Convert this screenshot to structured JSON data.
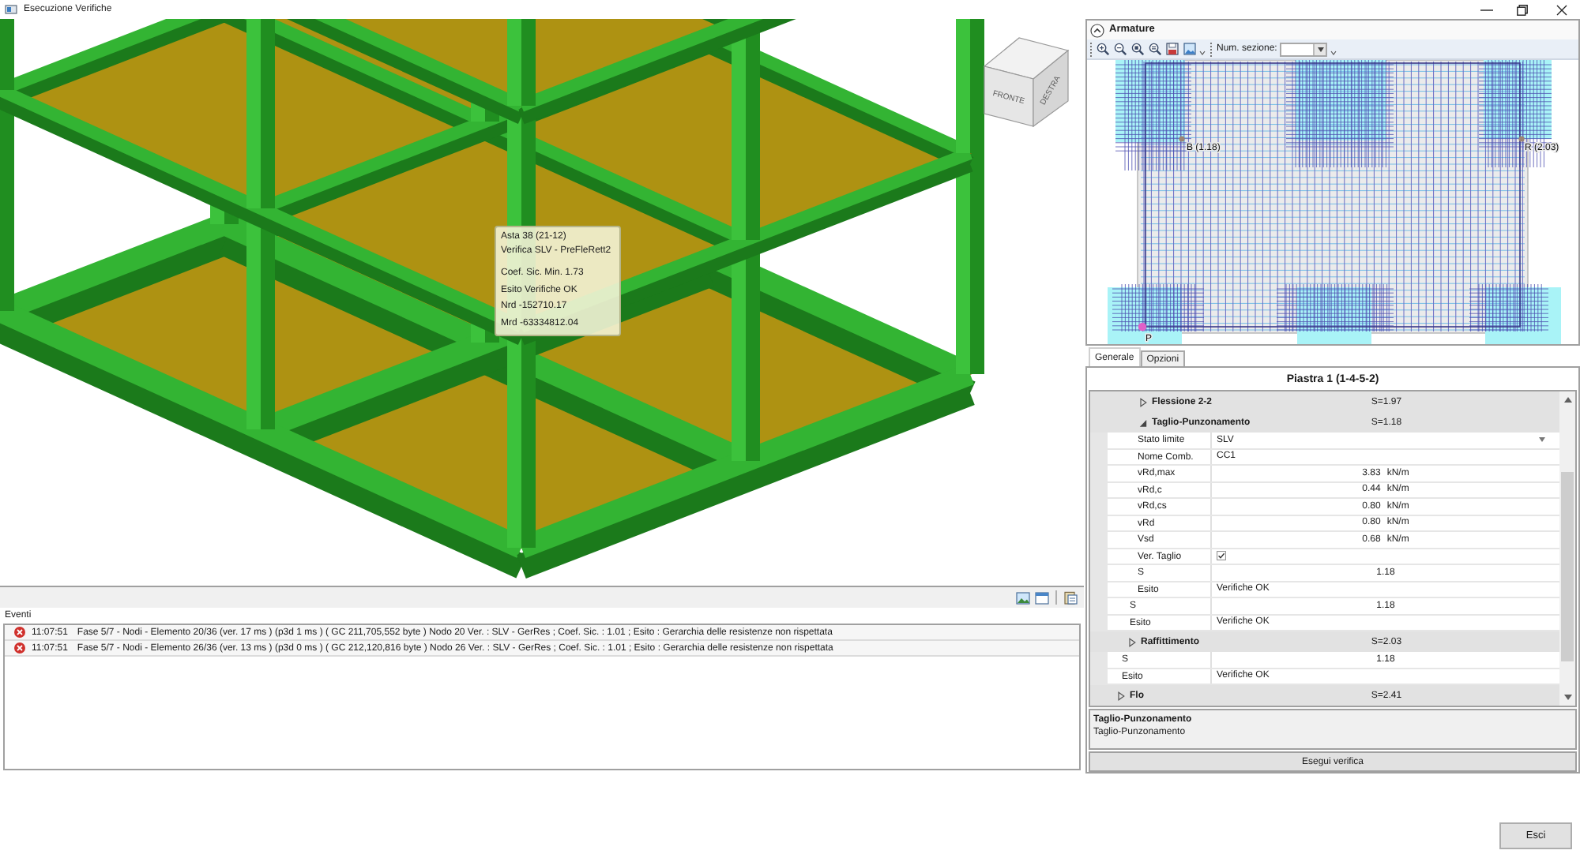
{
  "window": {
    "title": "Esecuzione Verifiche"
  },
  "viewport": {
    "tooltip": {
      "header": [
        "Asta 38 (21-12)",
        "Verifica SLV - PreFleRett2"
      ],
      "lines": [
        "Coef. Sic. Min. 1.73",
        "Esito Verifiche OK",
        "Nrd -152710.17",
        "Mrd -63334812.04"
      ]
    },
    "view_cube": {
      "front": "FRONTE",
      "right": "DESTRA"
    }
  },
  "events": {
    "label": "Eventi",
    "rows": [
      {
        "kind": "error",
        "time": "11:07:51",
        "message": "Fase 5/7 - Nodi - Elemento 20/36 (ver. 17 ms ) (p3d 1 ms ) ( GC 211,705,552 byte ) Nodo 20 Ver. : SLV - GerRes ; Coef. Sic. : 1.01 ; Esito : Gerarchia delle resistenze non rispettata"
      },
      {
        "kind": "error",
        "time": "11:07:51",
        "message": "Fase 5/7 - Nodi - Elemento 26/36 (ver. 13 ms ) (p3d 0 ms ) ( GC 212,120,816 byte ) Nodo 26 Ver. : SLV - GerRes ; Coef. Sic. : 1.01 ; Esito : Gerarchia delle resistenze non rispettata"
      }
    ]
  },
  "armature": {
    "title": "Armature",
    "expanded": true,
    "section_label": "Num. sezione:",
    "points": [
      {
        "label": "B (1.18)",
        "color": "#9c8474"
      },
      {
        "label": "R (2.03)",
        "color": "#9c8474"
      },
      {
        "label": "P",
        "color": "#e060c8"
      }
    ]
  },
  "tabs": [
    {
      "label": "Generale",
      "selected": true
    },
    {
      "label": "Opzioni",
      "selected": false
    }
  ],
  "properties": {
    "title": "Piastra 1 (1-4-5-2)",
    "rows": [
      {
        "kind": "group",
        "children": [
          {
            "kind": "group",
            "children": [
              {
                "kind": "category",
                "label": "Flessione 2-2",
                "value": "S=1.97",
                "expanded": false
              },
              {
                "kind": "category",
                "label": "Taglio-Punzonamento",
                "value": "S=1.18",
                "expanded": true,
                "children": [
                  {
                    "kind": "dropdown",
                    "label": "Stato limite",
                    "value": "SLV"
                  },
                  {
                    "kind": "text",
                    "label": "Nome Comb.",
                    "value": "CC1"
                  },
                  {
                    "kind": "number",
                    "label": "vRd,max",
                    "value": "3.83",
                    "unit": "kN/m"
                  },
                  {
                    "kind": "number",
                    "label": "vRd,c",
                    "value": "0.44",
                    "unit": "kN/m"
                  },
                  {
                    "kind": "number",
                    "label": "vRd,cs",
                    "value": "0.80",
                    "unit": "kN/m"
                  },
                  {
                    "kind": "number",
                    "label": "vRd",
                    "value": "0.80",
                    "unit": "kN/m"
                  },
                  {
                    "kind": "number",
                    "label": "Vsd",
                    "value": "0.68",
                    "unit": "kN/m"
                  },
                  {
                    "kind": "checkbox",
                    "label": "Ver. Taglio",
                    "checked": true
                  },
                  {
                    "kind": "number",
                    "label": "S",
                    "value": "1.18"
                  },
                  {
                    "kind": "text",
                    "label": "Esito",
                    "value": "Verifiche OK"
                  }
                ]
              },
              {
                "kind": "number",
                "label": "S",
                "value": "1.18"
              },
              {
                "kind": "text",
                "label": "Esito",
                "value": "Verifiche OK"
              }
            ]
          },
          {
            "kind": "category",
            "label": "Raffittimento",
            "value": "S=2.03",
            "expanded": false
          },
          {
            "kind": "number",
            "label": "S",
            "value": "1.18"
          },
          {
            "kind": "text",
            "label": "Esito",
            "value": "Verifiche OK"
          }
        ]
      },
      {
        "kind": "category",
        "label": "Flo",
        "value": "S=2.41",
        "expanded": false
      }
    ],
    "description": {
      "title": "Taglio-Punzonamento",
      "text": "Taglio-Punzonamento"
    },
    "run_button": "Esegui verifica"
  },
  "exit_button": "Esci"
}
